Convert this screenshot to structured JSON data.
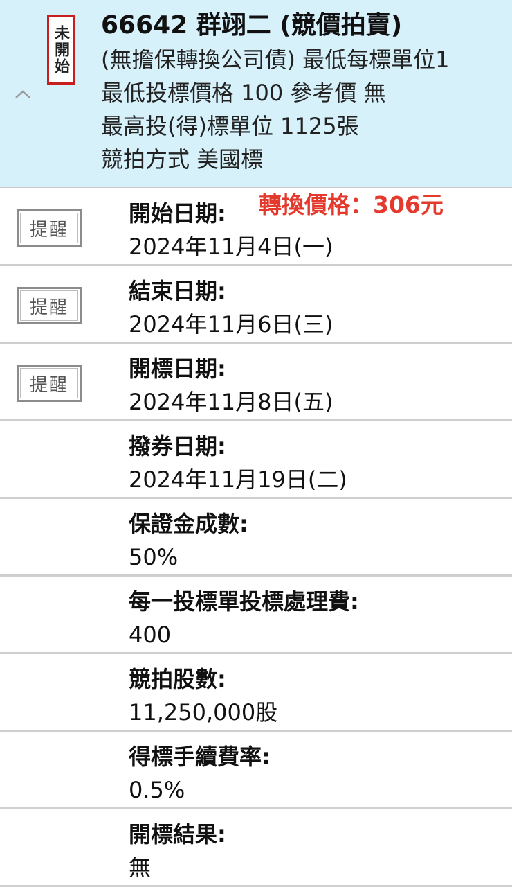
{
  "header": {
    "status_stamp": "未開始",
    "title": "66642 群翊二 (競價拍賣)",
    "lines": [
      "(無擔保轉換公司債) 最低每標單位1",
      "最低投標價格 100 參考價 無",
      "最高投(得)標單位 1125張",
      "競拍方式 美國標"
    ]
  },
  "conversion_note": "轉換價格：306元",
  "remind_label": "提醒",
  "rows": [
    {
      "label": "開始日期:",
      "value": "2024年11月4日(一)",
      "remind": true
    },
    {
      "label": "結束日期:",
      "value": "2024年11月6日(三)",
      "remind": true
    },
    {
      "label": "開標日期:",
      "value": "2024年11月8日(五)",
      "remind": true
    },
    {
      "label": "撥券日期:",
      "value": "2024年11月19日(二)",
      "remind": false
    },
    {
      "label": "保證金成數:",
      "value": "50%",
      "remind": false
    },
    {
      "label": "每一投標單投標處理費:",
      "value": "400",
      "remind": false
    },
    {
      "label": "競拍股數:",
      "value": "11,250,000股",
      "remind": false
    },
    {
      "label": "得標手續費率:",
      "value": "0.5%",
      "remind": false
    },
    {
      "label": "開標結果:",
      "value": "無",
      "remind": false
    }
  ],
  "icons": {
    "collapse": "chevron-up-icon"
  }
}
